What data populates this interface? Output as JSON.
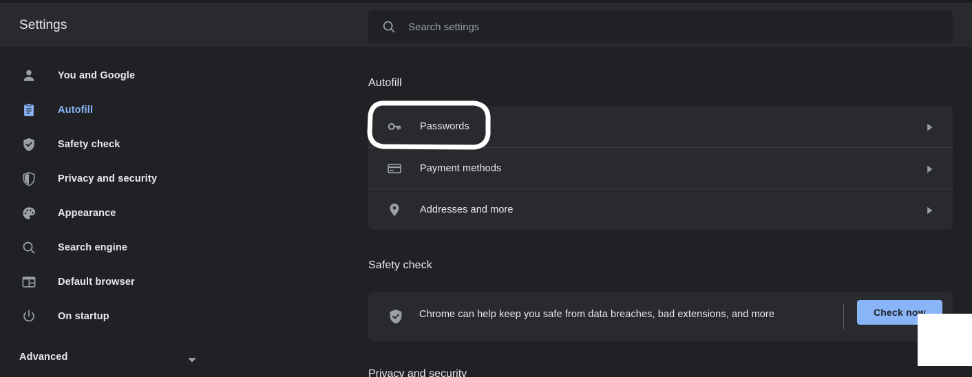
{
  "header": {
    "title": "Settings",
    "search": {
      "placeholder": "Search settings",
      "value": "",
      "icon": "search-icon"
    }
  },
  "sidebar": {
    "items": [
      {
        "label": "You and Google",
        "icon": "person-icon",
        "active": false
      },
      {
        "label": "Autofill",
        "icon": "clipboard-icon",
        "active": true
      },
      {
        "label": "Safety check",
        "icon": "shield-check-icon",
        "active": false
      },
      {
        "label": "Privacy and security",
        "icon": "shield-icon",
        "active": false
      },
      {
        "label": "Appearance",
        "icon": "palette-icon",
        "active": false
      },
      {
        "label": "Search engine",
        "icon": "search-icon",
        "active": false
      },
      {
        "label": "Default browser",
        "icon": "browser-window-icon",
        "active": false
      },
      {
        "label": "On startup",
        "icon": "power-icon",
        "active": false
      }
    ],
    "advanced": {
      "label": "Advanced",
      "icon": "chevron-down-icon"
    }
  },
  "main": {
    "autofill": {
      "title": "Autofill",
      "rows": [
        {
          "label": "Passwords",
          "icon": "key-icon",
          "arrow": "chevron-right-icon"
        },
        {
          "label": "Payment methods",
          "icon": "credit-card-icon",
          "arrow": "chevron-right-icon"
        },
        {
          "label": "Addresses and more",
          "icon": "location-pin-icon",
          "arrow": "chevron-right-icon"
        }
      ]
    },
    "safety_check": {
      "title": "Safety check",
      "description": "Chrome can help keep you safe from data breaches, bad extensions, and more",
      "icon": "shield-check-icon",
      "button_label": "Check now"
    },
    "next_section_title": "Privacy and security"
  },
  "annotations": {
    "highlight_target": "Passwords",
    "highlight_color": "#ffffff"
  },
  "colors": {
    "background": "#202124",
    "header_background": "#292a2d",
    "card_background": "#292a2d",
    "accent": "#8ab4f8",
    "text_primary": "#e8eaed",
    "text_secondary": "#9aa0a6",
    "divider": "#3c4043"
  }
}
